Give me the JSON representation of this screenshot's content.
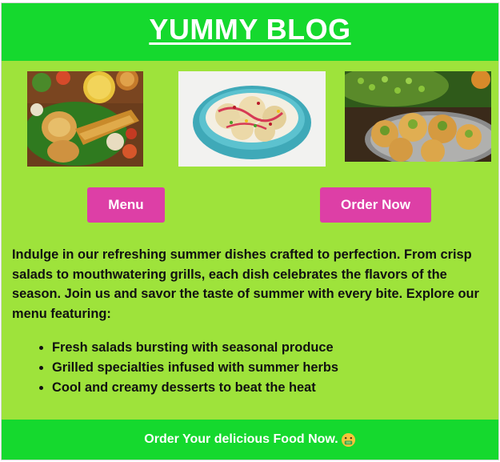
{
  "header": {
    "title": "YUMMY BLOG"
  },
  "images": [
    {
      "icon": "dosa-thali-photo"
    },
    {
      "icon": "dahi-puri-bowl-photo"
    },
    {
      "icon": "pani-puri-plate-photo"
    }
  ],
  "buttons": {
    "menu_label": "Menu",
    "order_label": "Order Now"
  },
  "intro": {
    "text": "Indulge in our refreshing summer dishes crafted to perfection. From crisp salads to mouthwatering grills, each dish celebrates the flavors of the season. Join us and savor the taste of summer with every bite. Explore our menu featuring:"
  },
  "features": [
    "Fresh salads bursting with seasonal produce",
    "Grilled specialties infused with summer herbs",
    "Cool and creamy desserts to beat the heat"
  ],
  "footer": {
    "text": "Order Your delicious Food Now.",
    "emoji_icon": "money-mouth-face-icon"
  },
  "colors": {
    "background": "#9ee33b",
    "header_footer": "#15d92e",
    "button": "#dd3fa6",
    "text_light": "#ffffff",
    "text_dark": "#111111"
  }
}
